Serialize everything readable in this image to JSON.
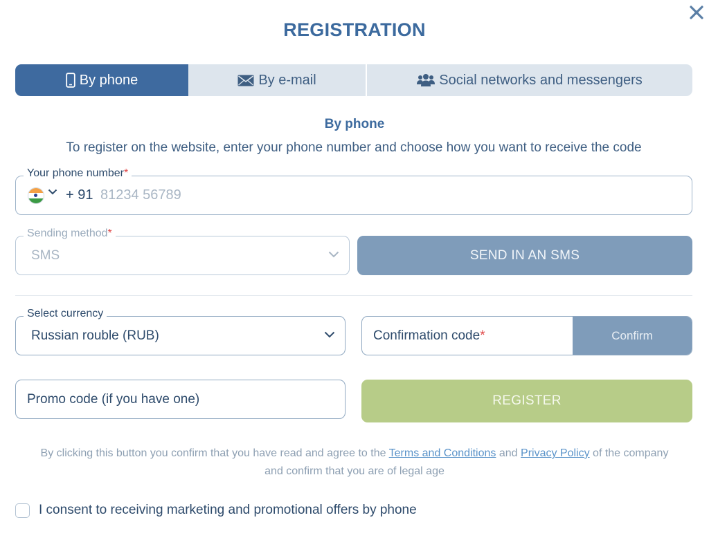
{
  "dialog": {
    "title": "REGISTRATION"
  },
  "tabs": [
    {
      "label": "By phone",
      "icon": "phone-icon",
      "active": true
    },
    {
      "label": "By e-mail",
      "icon": "envelope-icon",
      "active": false
    },
    {
      "label": "Social networks and messengers",
      "icon": "users-icon",
      "active": false
    }
  ],
  "section": {
    "title": "By phone",
    "description": "To register on the website, enter your phone number and choose how you want to receive the code"
  },
  "phone": {
    "label": "Your phone number",
    "required_mark": "*",
    "country_flag": "india-flag-icon",
    "dial_code": "+ 91",
    "placeholder": "81234 56789"
  },
  "sending_method": {
    "label": "Sending method",
    "required_mark": "*",
    "value": "SMS"
  },
  "send_button": {
    "label": "SEND IN AN SMS"
  },
  "currency": {
    "label": "Select currency",
    "value": "Russian rouble (RUB)"
  },
  "confirmation": {
    "label": "Confirmation code",
    "required_mark": "*",
    "button_label": "Confirm"
  },
  "promo": {
    "placeholder": "Promo code (if you have one)"
  },
  "register_button": {
    "label": "REGISTER"
  },
  "legal": {
    "text_before": "By clicking this button you confirm that you have read and agree to the",
    "terms_link": "Terms and Conditions",
    "and": "and",
    "privacy_link": "Privacy Policy",
    "text_after_line1": "of the company",
    "text_line2": "and confirm that you are of legal age"
  },
  "consent": {
    "label": "I consent to receiving marketing and promotional offers by phone",
    "checked": false
  },
  "colors": {
    "primary": "#3e6a9f",
    "tab_inactive_bg": "#dde5ed",
    "disabled_button": "#7f9cba",
    "register_button": "#b7cc88",
    "required": "#e04848",
    "link": "#5a93c9"
  }
}
